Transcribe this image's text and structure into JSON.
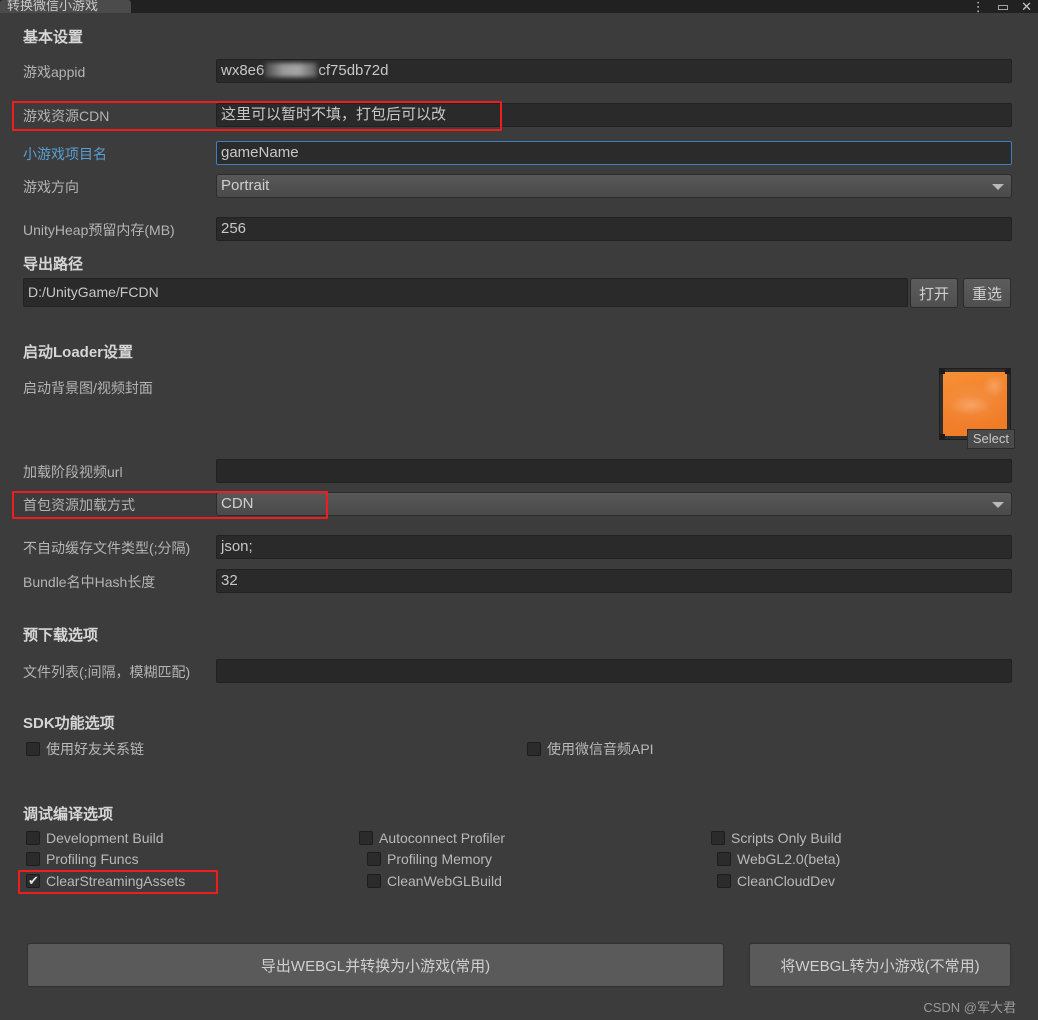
{
  "window": {
    "tab_title": "转换微信小游戏",
    "controls": [
      "⋮",
      "▭",
      "✕"
    ]
  },
  "sections": {
    "basic": {
      "title": "基本设置",
      "fields": [
        {
          "label": "游戏appid",
          "value": "wx8e6███cf75db72d",
          "type": "text",
          "redacted": true
        },
        {
          "label": "游戏资源CDN",
          "value": "这里可以暂时不填，打包后可以改",
          "type": "text",
          "highlight": true
        },
        {
          "label": "小游戏项目名",
          "value": "gameName",
          "type": "text",
          "focused": true,
          "label_accent": true
        },
        {
          "label": "游戏方向",
          "value": "Portrait",
          "type": "popup"
        },
        {
          "label": "UnityHeap预留内存(MB)",
          "value": "256",
          "type": "text"
        }
      ]
    },
    "export_path": {
      "title": "导出路径",
      "value": "D:/UnityGame/FCDN",
      "open_button": "打开",
      "reselect_button": "重选"
    },
    "loader": {
      "title": "启动Loader设置",
      "image_label": "启动背景图/视频封面",
      "image_select_badge": "Select",
      "fields": [
        {
          "label": "加载阶段视频url",
          "value": "",
          "type": "text"
        },
        {
          "label": "首包资源加载方式",
          "value": "CDN",
          "type": "popup",
          "highlight": true
        },
        {
          "label": "不自动缓存文件类型(;分隔)",
          "value": "json;",
          "type": "text"
        },
        {
          "label": "Bundle名中Hash长度",
          "value": "32",
          "type": "text"
        }
      ]
    },
    "preload": {
      "title": "预下载选项",
      "fields": [
        {
          "label": "文件列表(;间隔，模糊匹配)",
          "value": "",
          "type": "text"
        }
      ]
    },
    "sdk": {
      "title": "SDK功能选项",
      "checkboxes": [
        {
          "label": "使用好友关系链",
          "checked": false,
          "column": 0
        },
        {
          "label": "使用微信音频API",
          "checked": false,
          "column": 1
        }
      ]
    },
    "debug": {
      "title": "调试编译选项",
      "columns": [
        [
          {
            "label": "Development Build",
            "checked": false
          },
          {
            "label": "Profiling Funcs",
            "checked": false
          },
          {
            "label": "ClearStreamingAssets",
            "checked": true,
            "highlight": true
          }
        ],
        [
          {
            "label": "Autoconnect Profiler",
            "checked": false
          },
          {
            "label": "Profiling Memory",
            "checked": false
          },
          {
            "label": "CleanWebGLBuild",
            "checked": false
          }
        ],
        [
          {
            "label": "Scripts Only Build",
            "checked": false
          },
          {
            "label": "WebGL2.0(beta)",
            "checked": false
          },
          {
            "label": "CleanCloudDev",
            "checked": false
          }
        ]
      ]
    }
  },
  "actions": {
    "primary": "导出WEBGL并转换为小游戏(常用)",
    "secondary": "将WEBGL转为小游戏(不常用)"
  },
  "watermark": "CSDN @军大君",
  "colors": {
    "panel_bg": "#3c3c3c",
    "field_bg": "#2a2a2a",
    "accent_blue": "#5a9fd4",
    "highlight_red": "#f01d1d",
    "thumb_orange": "#f2802c"
  }
}
